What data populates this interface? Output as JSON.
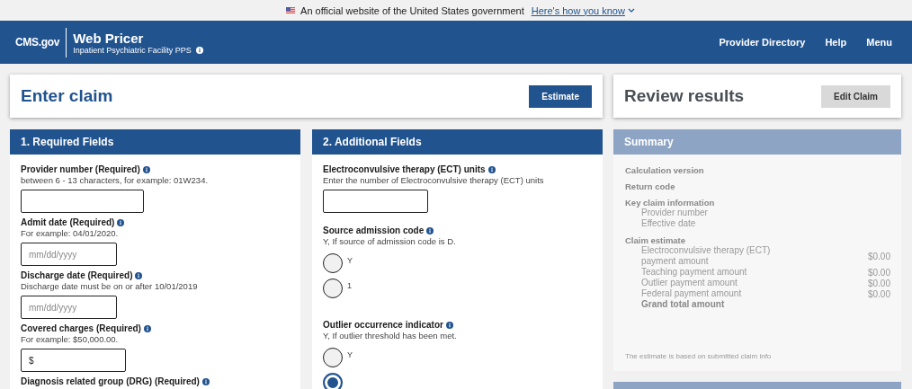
{
  "banner": {
    "text": "An official website of the United States government",
    "link": "Here's how you know"
  },
  "header": {
    "logo": "CMS.gov",
    "title": "Web Pricer",
    "subtitle": "Inpatient Psychiatric Facility PPS",
    "nav": [
      "Provider Directory",
      "Help",
      "Menu"
    ]
  },
  "enter_claim": {
    "title": "Enter claim",
    "button": "Estimate"
  },
  "required_fields": {
    "title": "1. Required Fields",
    "fields": [
      {
        "label": "Provider number (Required)",
        "hint": "between 6 - 13 characters, for example: 01W234.",
        "kind": "text"
      },
      {
        "label": "Admit date (Required)",
        "hint": "For example: 04/01/2020.",
        "kind": "text",
        "placeholder": "mm/dd/yyyy"
      },
      {
        "label": "Discharge date (Required)",
        "hint": "Discharge date must be on or after 10/01/2019",
        "kind": "text",
        "placeholder": "mm/dd/yyyy"
      },
      {
        "label": "Covered charges (Required)",
        "hint": "For example: $50,000.00.",
        "kind": "text",
        "value": "$"
      },
      {
        "label": "Diagnosis related group (DRG) (Required)",
        "kind": "label"
      }
    ]
  },
  "additional_fields": {
    "title": "2. Additional Fields",
    "fields": [
      {
        "label": "Electroconvulsive therapy (ECT) units",
        "hint": "Enter the number of Electroconvulsive therapy (ECT) units",
        "kind": "text"
      },
      {
        "label": "Source admission code",
        "hint": "Y, If source of admission code is D.",
        "kind": "radio",
        "options": [
          {
            "label": "Y",
            "selected": false
          },
          {
            "label": "1",
            "selected": false
          }
        ]
      },
      {
        "label": "Outlier occurrence indicator",
        "hint": "Y, If outlier threshold has been met.",
        "kind": "radio",
        "options": [
          {
            "label": "Y",
            "selected": false
          },
          {
            "selected": true
          }
        ]
      }
    ]
  },
  "review_results": {
    "title": "Review results",
    "button": "Edit Claim"
  },
  "summary": {
    "title": "Summary",
    "sections": [
      {
        "label": "Calculation version"
      },
      {
        "label": "Return code"
      },
      {
        "label": "Key claim information",
        "children": [
          {
            "label": "Provider number",
            "kind": "line"
          },
          {
            "label": "Effective date",
            "kind": "line"
          }
        ]
      },
      {
        "label": "Claim estimate",
        "children": [
          {
            "label": "Electroconvulsive therapy (ECT) payment amount",
            "kind": "line",
            "amount": "$0.00"
          },
          {
            "label": "Teaching payment amount",
            "kind": "line",
            "amount": "$0.00"
          },
          {
            "label": "Outlier payment amount",
            "kind": "line",
            "amount": "$0.00"
          },
          {
            "label": "Federal payment amount",
            "kind": "line",
            "amount": "$0.00"
          },
          {
            "label": "Grand total amount",
            "kind": "total"
          }
        ]
      }
    ],
    "note": "The estimate is based on submitted claim info"
  }
}
